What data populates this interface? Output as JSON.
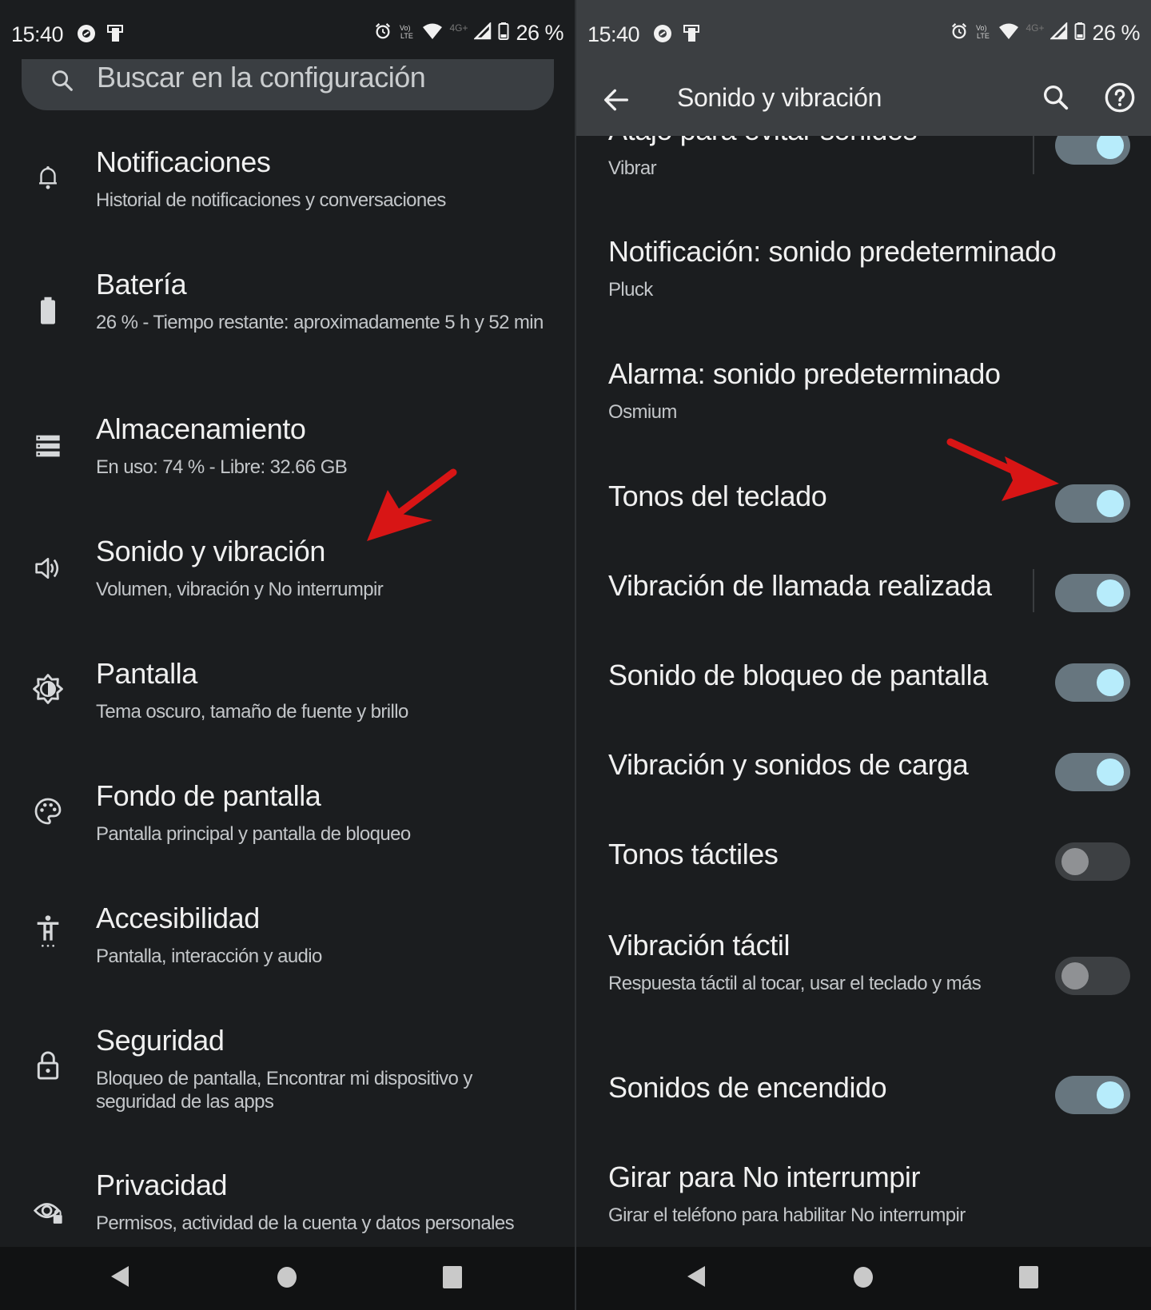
{
  "status_bar": {
    "time": "15:40",
    "battery_text": "26 %",
    "network_label": "4G+",
    "icons_left": [
      "sync-icon",
      "device-cast-icon"
    ],
    "icons_right": [
      "alarm-icon",
      "volte-icon",
      "wifi-icon",
      "network-4g-icon",
      "signal-icon",
      "battery-icon"
    ]
  },
  "left_screen": {
    "search": {
      "placeholder": "Buscar en la configuración",
      "icon": "search-icon"
    },
    "items": [
      {
        "icon": "bell-icon",
        "title": "Notificaciones",
        "subtitle": "Historial de notificaciones y conversaciones"
      },
      {
        "icon": "battery-icon",
        "title": "Batería",
        "subtitle": "26 % - Tiempo restante: aproximadamente 5 h y 52 min"
      },
      {
        "icon": "storage-icon",
        "title": "Almacenamiento",
        "subtitle": "En uso: 74 % - Libre: 32.66 GB"
      },
      {
        "icon": "volume-icon",
        "title": "Sonido y vibración",
        "subtitle": "Volumen, vibración y No interrumpir"
      },
      {
        "icon": "brightness-icon",
        "title": "Pantalla",
        "subtitle": "Tema oscuro, tamaño de fuente y brillo"
      },
      {
        "icon": "palette-icon",
        "title": "Fondo de pantalla",
        "subtitle": "Pantalla principal y pantalla de bloqueo"
      },
      {
        "icon": "accessibility-icon",
        "title": "Accesibilidad",
        "subtitle": "Pantalla, interacción y audio"
      },
      {
        "icon": "lock-icon",
        "title": "Seguridad",
        "subtitle": "Bloqueo de pantalla, Encontrar mi dispositivo y seguridad de las apps"
      },
      {
        "icon": "privacy-eye-icon",
        "title": "Privacidad",
        "subtitle": "Permisos, actividad de la cuenta y datos personales"
      }
    ]
  },
  "right_screen": {
    "app_bar": {
      "title": "Sonido y vibración",
      "back_icon": "back-arrow-icon",
      "search_icon": "search-icon",
      "help_icon": "help-icon"
    },
    "items": [
      {
        "title": "Atajo para evitar sonidos",
        "subtitle": "Vibrar",
        "toggle": true
      },
      {
        "title": "Notificación: sonido predeterminado",
        "subtitle": "Pluck"
      },
      {
        "title": "Alarma: sonido predeterminado",
        "subtitle": "Osmium"
      },
      {
        "title": "Tonos del teclado",
        "toggle": true
      },
      {
        "title": "Vibración de llamada realizada",
        "toggle": true
      },
      {
        "title": "Sonido de bloqueo de pantalla",
        "toggle": true
      },
      {
        "title": "Vibración y sonidos de carga",
        "toggle": true
      },
      {
        "title": "Tonos táctiles",
        "toggle": false
      },
      {
        "title": "Vibración táctil",
        "subtitle": "Respuesta táctil al tocar, usar el teclado y más",
        "toggle": false
      },
      {
        "title": "Sonidos de encendido",
        "toggle": true
      },
      {
        "title": "Girar para No interrumpir",
        "subtitle": "Girar el teléfono para habilitar No interrumpir"
      }
    ]
  },
  "nav_bar": {
    "buttons": [
      "back",
      "home",
      "recents"
    ]
  },
  "annotations": {
    "arrow_color": "#d81515",
    "targets": [
      "Sonido y vibración",
      "Tonos del teclado toggle"
    ]
  },
  "colors": {
    "background": "#1b1d1f",
    "toggle_on_track": "#67767f",
    "toggle_on_knob": "#b7ecfb",
    "toggle_off_track": "#3d4043",
    "toggle_off_knob": "#8f9194",
    "app_bar": "#3c3f42"
  }
}
